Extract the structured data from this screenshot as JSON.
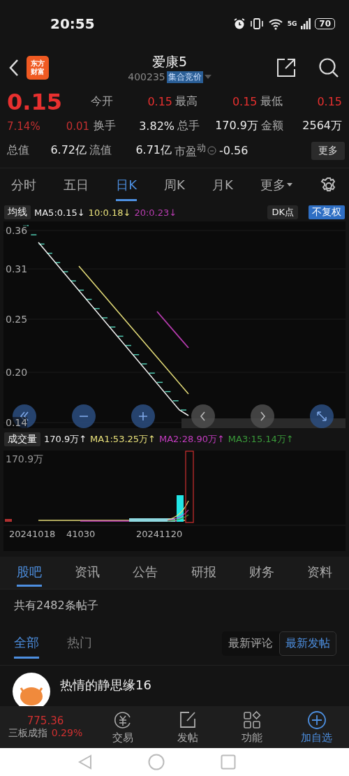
{
  "status_bar": {
    "time": "20:55",
    "network": "5G",
    "battery": "70"
  },
  "header": {
    "logo": [
      "东方",
      "财富"
    ],
    "title": "爱康5",
    "code": "400235",
    "tag": "集合竞价"
  },
  "quote": {
    "rows": [
      [
        {
          "value": "0.15",
          "kind": "price"
        },
        {
          "label": "今开",
          "value": "0.15",
          "kind": "up"
        },
        {
          "label": "最高",
          "value": "0.15",
          "kind": "up"
        },
        {
          "label": "最低",
          "value": "0.15",
          "kind": "up"
        }
      ],
      [
        {
          "value": "7.14%",
          "delta": "0.01",
          "kind": "change"
        },
        {
          "label": "换手",
          "value": "3.82%",
          "kind": "flat"
        },
        {
          "label": "总手",
          "value": "170.9万",
          "kind": "flat"
        },
        {
          "label": "金额",
          "value": "2564万",
          "kind": "flat"
        }
      ],
      [
        {
          "label": "总值",
          "value": "6.72亿",
          "kind": "flat"
        },
        {
          "label": "流值",
          "value": "6.71亿",
          "kind": "flat"
        },
        {
          "label": "市盈$^{动}$",
          "value": "-0.56",
          "kind": "flat"
        }
      ]
    ],
    "more_button": "更多"
  },
  "period_tabs": [
    {
      "label": "分时",
      "selected": false
    },
    {
      "label": "五日",
      "selected": false
    },
    {
      "label": "日K",
      "selected": true
    },
    {
      "label": "周K",
      "selected": false
    },
    {
      "label": "月K",
      "selected": false
    },
    {
      "label": "更多",
      "selected": false
    }
  ],
  "ma_bar": {
    "dropdown": "均线",
    "items": [
      {
        "text": "MA5:0.15↓",
        "color": "#f2f2f2"
      },
      {
        "text": "10:0.18↓",
        "color": "#e8e07a"
      },
      {
        "text": "20:0.23↓",
        "color": "#b83cb0"
      }
    ],
    "dk_button": "DK点",
    "adjust_button": "不复权"
  },
  "price_axis": [
    "0.36",
    "0.31",
    "0.25",
    "0.20",
    "0.14"
  ],
  "volume_bar": {
    "dropdown": "成交量",
    "items": [
      {
        "text": "170.9万↑",
        "color": "#f2f2f2"
      },
      {
        "text": "MA1:53.25万↑",
        "color": "#e8e07a"
      },
      {
        "text": "MA2:28.90万↑",
        "color": "#c43cc0"
      },
      {
        "text": "MA3:15.14万↑",
        "color": "#3a9a3a"
      }
    ]
  },
  "volume_axis": "170.9万",
  "dates": [
    "20241018",
    "41030",
    "20241120"
  ],
  "section_tabs": [
    {
      "label": "股吧",
      "selected": true
    },
    {
      "label": "资讯",
      "selected": false
    },
    {
      "label": "公告",
      "selected": false
    },
    {
      "label": "研报",
      "selected": false
    },
    {
      "label": "财务",
      "selected": false
    },
    {
      "label": "资料",
      "selected": false
    }
  ],
  "post_count": "共有2482条帖子",
  "filter_tabs": [
    {
      "label": "全部",
      "selected": true
    },
    {
      "label": "热门",
      "selected": false
    }
  ],
  "sort_options": [
    {
      "label": "最新评论",
      "selected": false
    },
    {
      "label": "最新发帖",
      "selected": true
    }
  ],
  "posts": [
    {
      "author": "热情的静思缘16"
    }
  ],
  "bottom_bar": {
    "index_value": "775.36",
    "index_name": "三板成指",
    "index_change": "0.29%",
    "items": [
      {
        "label": "交易",
        "highlighted": false
      },
      {
        "label": "发帖",
        "highlighted": false
      },
      {
        "label": "功能",
        "highlighted": false
      },
      {
        "label": "加自选",
        "highlighted": true
      }
    ]
  }
}
